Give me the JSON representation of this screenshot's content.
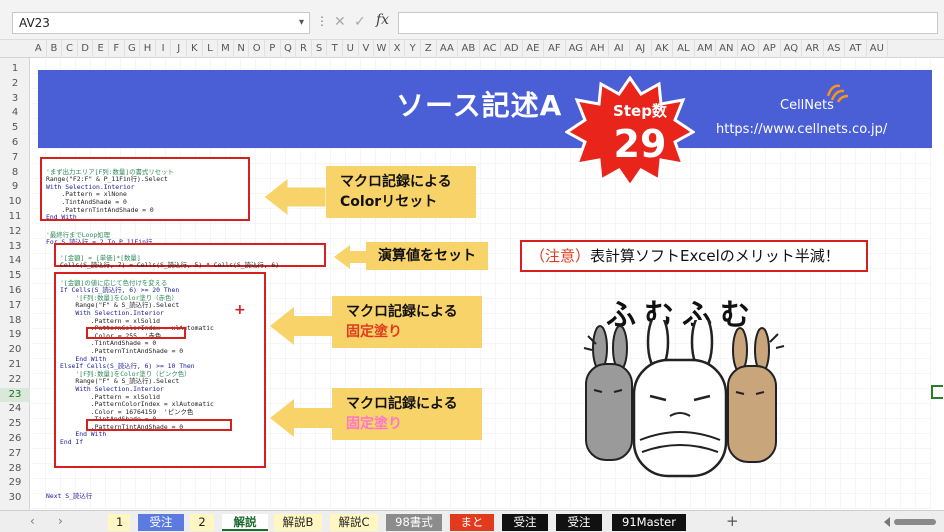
{
  "formula_bar": {
    "name_box": "AV23",
    "cancel_icon": "cancel-x-icon",
    "enter_icon": "enter-check-icon",
    "fx_label": "fx",
    "formula_value": ""
  },
  "columns": [
    "A",
    "B",
    "C",
    "D",
    "E",
    "F",
    "G",
    "H",
    "I",
    "J",
    "K",
    "L",
    "M",
    "N",
    "O",
    "P",
    "Q",
    "R",
    "S",
    "T",
    "U",
    "V",
    "W",
    "X",
    "Y",
    "Z",
    "AA",
    "AB",
    "AC",
    "AD",
    "AE",
    "AF",
    "AG",
    "AH",
    "AI",
    "AJ",
    "AK",
    "AL",
    "AM",
    "AN",
    "AO",
    "AP",
    "AQ",
    "AR",
    "AS",
    "AT",
    "AU"
  ],
  "rows": [
    "1",
    "2",
    "3",
    "4",
    "5",
    "6",
    "7",
    "8",
    "9",
    "10",
    "11",
    "12",
    "13",
    "14",
    "15",
    "16",
    "17",
    "18",
    "19",
    "20",
    "21",
    "22",
    "23",
    "24",
    "25",
    "26",
    "27",
    "28",
    "29",
    "30"
  ],
  "active_row": "23",
  "banner": {
    "title": "ソース記述A",
    "step_label": "Step数",
    "step_count": "29",
    "brand": "CellNets",
    "url": "https://www.cellnets.co.jp/",
    "color": "#4a5ed6"
  },
  "code_block_1": {
    "lines": [
      "'まず出力エリア[F列:数量]の書式リセット",
      "Range(\"F2:F\" & P_11Fin行).Select",
      "With Selection.Interior",
      "    .Pattern = xlNone",
      "    .TintAndShade = 0",
      "    .PatternTintAndShade = 0",
      "End With"
    ]
  },
  "loop_header": {
    "lines": [
      "'最終行までLoop処理",
      "For S_読込行 = 2 To P_11Fin行"
    ]
  },
  "code_block_2": {
    "lines": [
      "'[金額] = [単価]*[数量]",
      "Cells(S_読込行, 7) = Cells(S_読込行, 5) * Cells(S_読込行, 6)"
    ]
  },
  "code_block_3": {
    "lines": [
      "'[金額]の値に応じて色付けを変える",
      "If Cells(S_読込行, 6) >= 20 Then",
      "",
      "    '[F列:数量]をColor塗り（赤色）",
      "    Range(\"F\" & S_読込行).Select",
      "    With Selection.Interior",
      "        .Pattern = xlSolid",
      "        .PatternColorIndex = xlAutomatic",
      "        .Color = 255  '赤色",
      "        .TintAndShade = 0",
      "        .PatternTintAndShade = 0",
      "    End With",
      "",
      "ElseIf Cells(S_読込行, 6) >= 10 Then",
      "",
      "    '[F列:数量]をColor塗り（ピンク色）",
      "    Range(\"F\" & S_読込行).Select",
      "    With Selection.Interior",
      "        .Pattern = xlSolid",
      "        .PatternColorIndex = xlAutomatic",
      "        .Color = 16764159  'ピンク色",
      "        .TintAndShade = 0",
      "        .PatternTintAndShade = 0",
      "    End With",
      "",
      "End If"
    ]
  },
  "loop_footer": "Next S_読込行",
  "callouts": {
    "c1_line1": "マクロ記録による",
    "c1_line2": "Colorリセット",
    "c2": "演算値をセット",
    "c3_line1": "マクロ記録による",
    "c3_line2": "固定塗り",
    "c4_line1": "マクロ記録による",
    "c4_line2": "固定塗り"
  },
  "note": {
    "prefix": "（注意）",
    "text": "表計算ソフトExcelのメリット半減！"
  },
  "illustration": {
    "caption": "ふむふむ"
  },
  "sheet_tabs": [
    {
      "label": "1",
      "bg": "#fff6c2",
      "fg": "#222"
    },
    {
      "label": "受注A",
      "bg": "#5b7be0",
      "fg": "#ffffff"
    },
    {
      "label": "2",
      "bg": "#fff6c2",
      "fg": "#222"
    },
    {
      "label": "解説A",
      "bg": "#ffffff",
      "fg": "#1e6b2e",
      "active": true
    },
    {
      "label": "解説B",
      "bg": "#fff6c2",
      "fg": "#222"
    },
    {
      "label": "解説C",
      "bg": "#fff6c2",
      "fg": "#222"
    },
    {
      "label": "98書式",
      "bg": "#8c8c8c",
      "fg": "#ffffff"
    },
    {
      "label": "まとめ",
      "bg": "#e23a1d",
      "fg": "#ffffff"
    },
    {
      "label": "受注B",
      "bg": "#111111",
      "fg": "#ffffff"
    },
    {
      "label": "受注C",
      "bg": "#111111",
      "fg": "#ffffff"
    },
    {
      "label": "91Master",
      "bg": "#111111",
      "fg": "#ffffff"
    }
  ],
  "add_sheet_label": "+"
}
